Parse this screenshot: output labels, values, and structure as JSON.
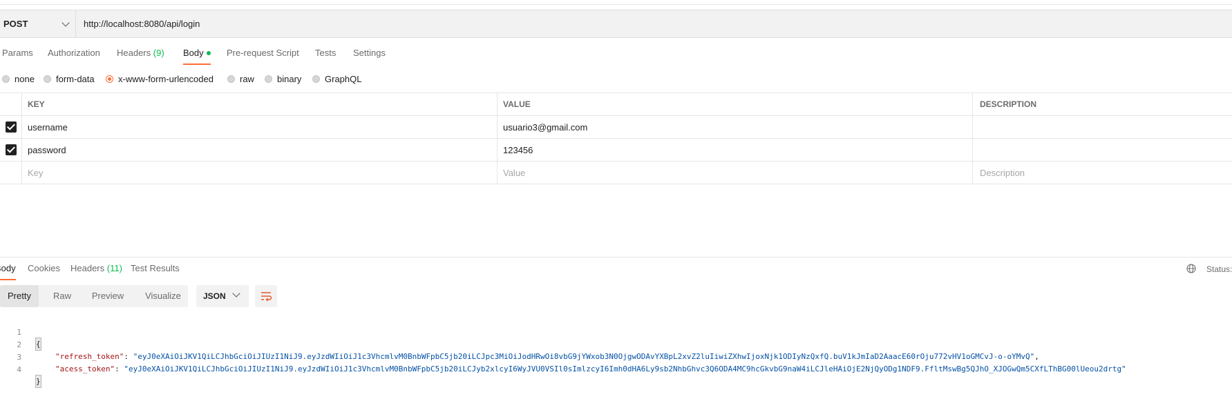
{
  "request": {
    "method": "POST",
    "url": "http://localhost:8080/api/login"
  },
  "request_tabs": [
    {
      "label": "Params"
    },
    {
      "label": "Authorization"
    },
    {
      "label": "Headers",
      "count": "(9)"
    },
    {
      "label": "Body"
    },
    {
      "label": "Pre-request Script"
    },
    {
      "label": "Tests"
    },
    {
      "label": "Settings"
    }
  ],
  "body_types": [
    {
      "label": "none",
      "selected": false
    },
    {
      "label": "form-data",
      "selected": false
    },
    {
      "label": "x-www-form-urlencoded",
      "selected": true
    },
    {
      "label": "raw",
      "selected": false
    },
    {
      "label": "binary",
      "selected": false
    },
    {
      "label": "GraphQL",
      "selected": false
    }
  ],
  "params_table": {
    "headers": [
      "KEY",
      "VALUE",
      "DESCRIPTION"
    ],
    "rows": [
      {
        "checked": true,
        "key": "username",
        "value": "usuario3@gmail.com",
        "description": ""
      },
      {
        "checked": true,
        "key": "password",
        "value": "123456",
        "description": ""
      }
    ],
    "placeholders": {
      "key": "Key",
      "value": "Value",
      "description": "Description"
    }
  },
  "response_tabs": [
    {
      "label": "Body"
    },
    {
      "label": "Cookies"
    },
    {
      "label": "Headers",
      "count": "(11)"
    },
    {
      "label": "Test Results"
    }
  ],
  "response_status_label": "Status:",
  "format_options": [
    "Pretty",
    "Raw",
    "Preview",
    "Visualize"
  ],
  "language": "JSON",
  "response_body": {
    "line_numbers": [
      "1",
      "2",
      "3",
      "4"
    ],
    "open_brace": "{",
    "close_brace": "}",
    "fields": [
      {
        "key": "\"refresh_token\"",
        "value": "\"eyJ0eXAiOiJKV1QiLCJhbGciOiJIUzI1NiJ9.eyJzdWIiOiJ1c3VhcmlvM0BnbWFpbC5jb20iLCJpc3MiOiJodHRwOi8vbG9jYWxob3N0OjgwODAvYXBpL2xvZ2luIiwiZXhwIjoxNjk1ODIyNzQxfQ.buV1kJmIaD2AaacE60rOju772vHV1oGMCvJ-o-oYMvQ\"",
        "trailing": ","
      },
      {
        "key": "\"acess_token\"",
        "value": "\"eyJ0eXAiOiJKV1QiLCJhbGciOiJIUzI1NiJ9.eyJzdWIiOiJ1c3VhcmlvM0BnbWFpbC5jb20iLCJyb2xlcyI6WyJVU0VSIl0sImlzcyI6Imh0dHA6Ly9sb2NhbGhvc3Q6ODA4MC9hcGkvbG9naW4iLCJleHAiOjE2NjQyODg1NDF9.FfltMswBg5QJhO_XJOGwQm5CXfLThBG00lUeou2drtg\"",
        "trailing": ""
      }
    ]
  },
  "colors": {
    "accent": "#ff6c37",
    "success_green": "#0cbb52",
    "json_key": "#a31515",
    "json_string": "#0451a5"
  },
  "icons": [
    "chevron-down-icon",
    "checkbox-checked-icon",
    "globe-icon",
    "wrap-lines-icon"
  ]
}
